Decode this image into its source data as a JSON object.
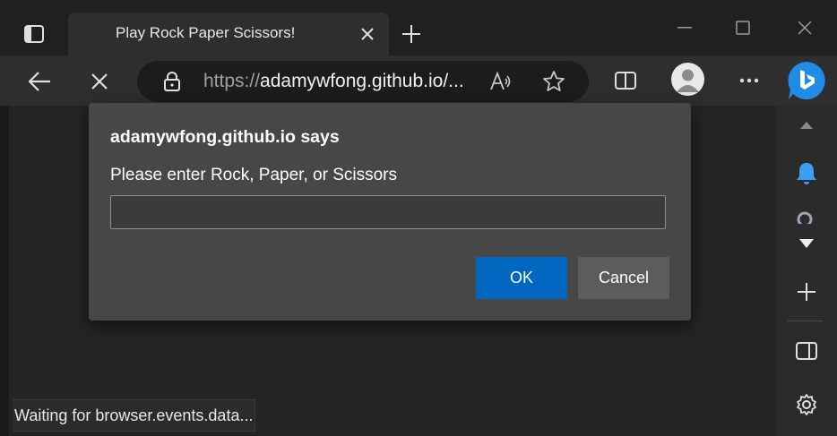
{
  "tab": {
    "title": "Play Rock Paper Scissors!"
  },
  "address_bar": {
    "scheme": "https://",
    "host_display": "adamywfong.github.io/..."
  },
  "dialog": {
    "title": "adamywfong.github.io says",
    "message": "Please enter Rock, Paper, or Scissors",
    "input_value": "",
    "ok_label": "OK",
    "cancel_label": "Cancel"
  },
  "status_bar": {
    "text": "Waiting for browser.events.data..."
  },
  "colors": {
    "accent_ok_button": "#0067c0",
    "bing_blue": "#1f8ce6",
    "notification_blue": "#3d9df0"
  },
  "icons": {
    "tab_actions": "tab-actions-icon",
    "tab_close": "close-icon",
    "new_tab": "plus-icon",
    "back": "arrow-left-icon",
    "stop": "close-icon",
    "lock": "lock-icon",
    "read_aloud": "read-aloud-icon",
    "favorite": "star-icon",
    "split_screen": "split-screen-icon",
    "profile": "profile-icon",
    "more": "ellipsis-icon",
    "copilot": "bing-icon"
  }
}
